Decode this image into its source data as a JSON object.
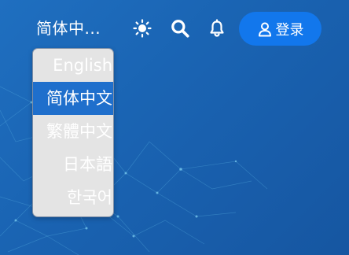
{
  "header": {
    "current_language": "简体中...",
    "sun_icon": "sun-icon",
    "search_icon": "search-icon",
    "bell_icon": "bell-icon",
    "login": {
      "label": "登录",
      "icon": "user-icon"
    }
  },
  "language_menu": {
    "selected_index": 1,
    "items": [
      {
        "label": "English"
      },
      {
        "label": "简体中文"
      },
      {
        "label": "繁體中文"
      },
      {
        "label": "日本語"
      },
      {
        "label": "한국어"
      }
    ]
  },
  "colors": {
    "background": "#1a64b3",
    "login_button": "#1277ec",
    "menu_background": "#e4e4e4",
    "menu_selected": "#1f6fcc",
    "text": "#ffffff"
  }
}
